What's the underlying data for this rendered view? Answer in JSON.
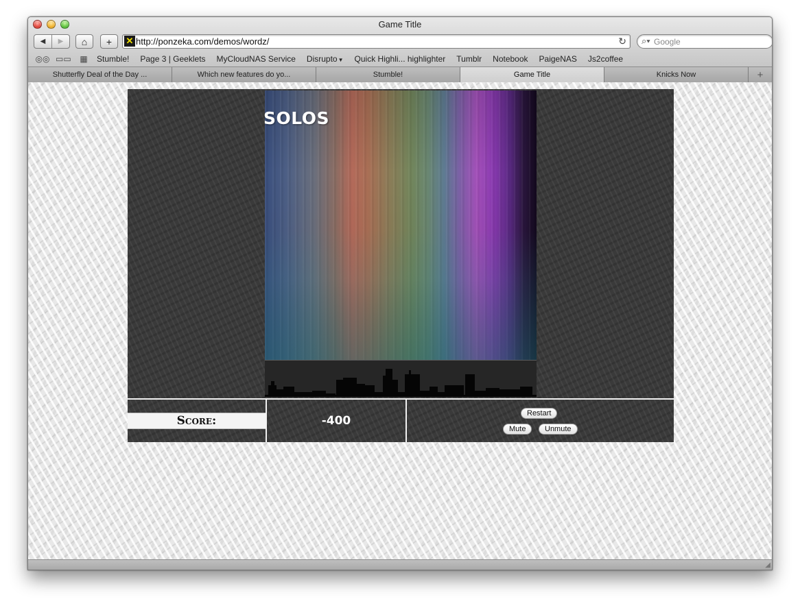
{
  "window": {
    "title": "Game Title"
  },
  "toolbar": {
    "url": "http://ponzeka.com/demos/wordz/",
    "search_placeholder": "Google"
  },
  "bookmarks": [
    "Stumble!",
    "Page 3 | Geeklets",
    "MyCloudNAS Service",
    "Disrupto",
    "Quick Highli... highlighter",
    "Tumblr",
    "Notebook",
    "PaigeNAS",
    "Js2coffee"
  ],
  "tabs": [
    {
      "label": "Shutterfly Deal of the Day ...",
      "active": false
    },
    {
      "label": "Which new features do yo...",
      "active": false
    },
    {
      "label": "Stumble!",
      "active": false
    },
    {
      "label": "Game Title",
      "active": true
    },
    {
      "label": "Knicks Now",
      "active": false
    }
  ],
  "game": {
    "falling_word": "SOLOS",
    "score_label": "Score:",
    "score_value": "-400",
    "buttons": {
      "restart": "Restart",
      "mute": "Mute",
      "unmute": "Unmute"
    }
  },
  "colors": {
    "board_background": "#3a3a3a",
    "panel_divider": "#f2f2f2",
    "word_color": "#ffffff"
  }
}
